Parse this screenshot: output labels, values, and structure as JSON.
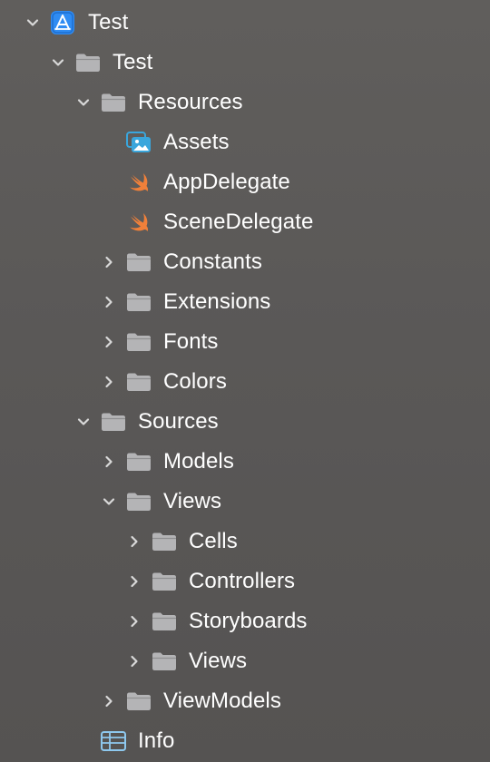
{
  "tree": {
    "project": {
      "label": "Test",
      "icon": "xcode-project-icon",
      "expanded": true
    },
    "group_test": {
      "label": "Test",
      "icon": "folder-icon",
      "expanded": true
    },
    "resources": {
      "label": "Resources",
      "icon": "folder-icon",
      "expanded": true
    },
    "assets": {
      "label": "Assets",
      "icon": "asset-catalog-icon"
    },
    "app_delegate": {
      "label": "AppDelegate",
      "icon": "swift-file-icon"
    },
    "scene_delegate": {
      "label": "SceneDelegate",
      "icon": "swift-file-icon"
    },
    "constants": {
      "label": "Constants",
      "icon": "folder-icon",
      "expanded": false
    },
    "extensions": {
      "label": "Extensions",
      "icon": "folder-icon",
      "expanded": false
    },
    "fonts": {
      "label": "Fonts",
      "icon": "folder-icon",
      "expanded": false
    },
    "colors": {
      "label": "Colors",
      "icon": "folder-icon",
      "expanded": false
    },
    "sources": {
      "label": "Sources",
      "icon": "folder-icon",
      "expanded": true
    },
    "models": {
      "label": "Models",
      "icon": "folder-icon",
      "expanded": false
    },
    "views": {
      "label": "Views",
      "icon": "folder-icon",
      "expanded": true
    },
    "cells": {
      "label": "Cells",
      "icon": "folder-icon",
      "expanded": false
    },
    "controllers": {
      "label": "Controllers",
      "icon": "folder-icon",
      "expanded": false
    },
    "storyboards": {
      "label": "Storyboards",
      "icon": "folder-icon",
      "expanded": false
    },
    "views_inner": {
      "label": "Views",
      "icon": "folder-icon",
      "expanded": false
    },
    "view_models": {
      "label": "ViewModels",
      "icon": "folder-icon",
      "expanded": false
    },
    "info": {
      "label": "Info",
      "icon": "plist-file-icon"
    }
  },
  "colors": {
    "background": "#5a5857",
    "text": "#ffffff",
    "chevron": "#d9d9d9",
    "folder": "#b4b4b6",
    "project_icon": "#2f8cf3",
    "asset_icon": "#3aa6dc",
    "swift_icon": "#f0803a",
    "plist_icon": "#8ec8ee"
  }
}
